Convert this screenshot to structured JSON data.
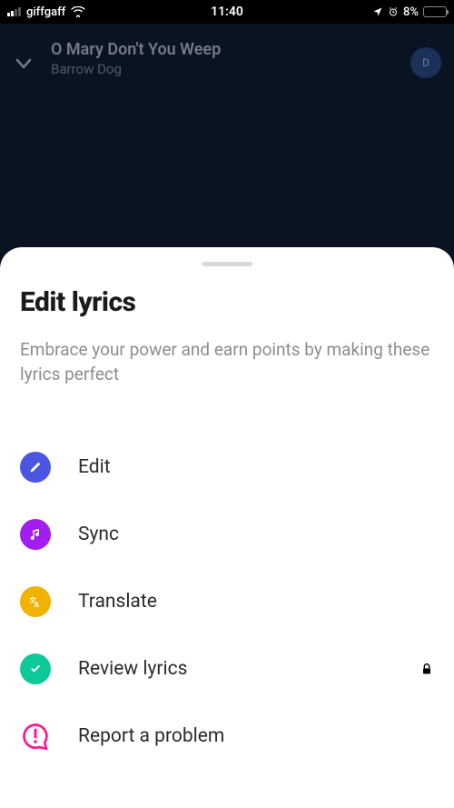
{
  "status": {
    "carrier": "giffgaff",
    "time": "11:40",
    "battery_percent": "8%"
  },
  "player": {
    "title": "O Mary Don't You Weep",
    "artist": "Barrow Dog",
    "avatar_letter": "D"
  },
  "sheet": {
    "title": "Edit lyrics",
    "description": "Embrace your power and earn points by making these lyrics perfect",
    "options": {
      "edit": "Edit",
      "sync": "Sync",
      "translate": "Translate",
      "review": "Review lyrics",
      "report": "Report a problem"
    }
  },
  "colors": {
    "edit": "#4a56e2",
    "sync": "#a31cf0",
    "translate": "#f2b200",
    "review": "#0dc99a",
    "report": "#ff1a8c"
  }
}
